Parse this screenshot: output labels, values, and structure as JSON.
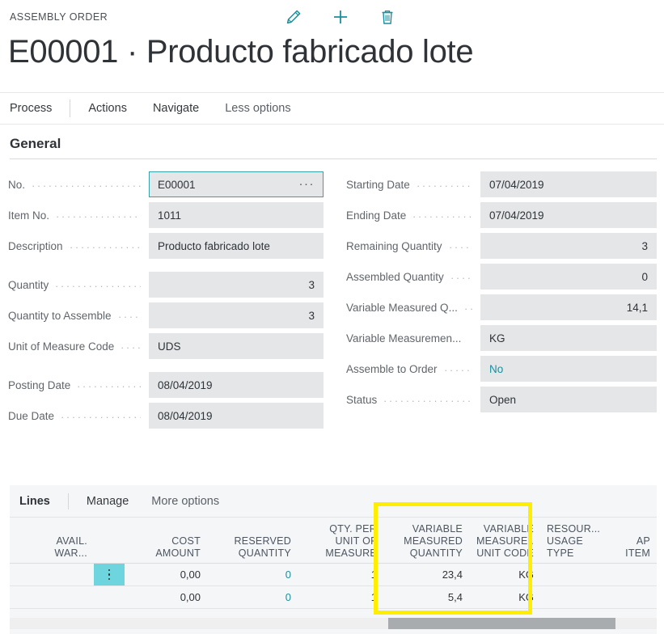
{
  "header": {
    "breadcrumb": "ASSEMBLY ORDER",
    "title_no": "E00001",
    "title_sep": "·",
    "title_desc": "Producto fabricado lote",
    "icons": [
      {
        "name": "edit-pencil-icon",
        "label": "Edit"
      },
      {
        "name": "plus-icon",
        "label": "New"
      },
      {
        "name": "trash-icon",
        "label": "Delete"
      }
    ]
  },
  "ribbon": {
    "process": "Process",
    "actions": "Actions",
    "navigate": "Navigate",
    "less_options": "Less options"
  },
  "general": {
    "heading": "General",
    "left": [
      {
        "label": "No.",
        "value": "E00001",
        "align": "left",
        "focused": true,
        "assist": "···"
      },
      {
        "label": "Item No.",
        "value": "1011",
        "align": "left"
      },
      {
        "label": "Description",
        "value": "Producto fabricado lote",
        "align": "left"
      },
      {
        "label": "Quantity",
        "value": "3",
        "align": "right",
        "gap": true
      },
      {
        "label": "Quantity to Assemble",
        "value": "3",
        "align": "right"
      },
      {
        "label": "Unit of Measure Code",
        "value": "UDS",
        "align": "left"
      },
      {
        "label": "Posting Date",
        "value": "08/04/2019",
        "align": "left",
        "gap": true
      },
      {
        "label": "Due Date",
        "value": "08/04/2019",
        "align": "left"
      }
    ],
    "right": [
      {
        "label": "Starting Date",
        "value": "07/04/2019",
        "align": "left"
      },
      {
        "label": "Ending Date",
        "value": "07/04/2019",
        "align": "left"
      },
      {
        "label": "Remaining Quantity",
        "value": "3",
        "align": "right"
      },
      {
        "label": "Assembled Quantity",
        "value": "0",
        "align": "right"
      },
      {
        "label": "Variable Measured Q...",
        "value": "14,1",
        "align": "right"
      },
      {
        "label": "Variable Measuremen...",
        "value": "KG",
        "align": "left"
      },
      {
        "label": "Assemble to Order",
        "value": "No",
        "align": "left",
        "link": true
      },
      {
        "label": "Status",
        "value": "Open",
        "align": "left"
      }
    ]
  },
  "lines": {
    "title": "Lines",
    "manage": "Manage",
    "more_options": "More options",
    "columns": [
      {
        "key": "avail",
        "lines": [
          "AVAIL.",
          "WAR..."
        ],
        "align": "right"
      },
      {
        "key": "sel",
        "lines": [],
        "align": "left"
      },
      {
        "key": "cost",
        "lines": [
          "COST",
          "AMOUNT"
        ],
        "align": "right"
      },
      {
        "key": "resv",
        "lines": [
          "RESERVED",
          "QUANTITY"
        ],
        "align": "right"
      },
      {
        "key": "qpu",
        "lines": [
          "QTY. PER",
          "UNIT OF",
          "MEASURE"
        ],
        "align": "right"
      },
      {
        "key": "vmq",
        "lines": [
          "VARIABLE",
          "MEASURED",
          "QUANTITY"
        ],
        "align": "right"
      },
      {
        "key": "vmu",
        "lines": [
          "VARIABLE",
          "MEASURE..",
          "UNIT CODE"
        ],
        "align": "right"
      },
      {
        "key": "rut",
        "lines": [
          "RESOUR...",
          "USAGE",
          "TYPE"
        ],
        "align": "left"
      },
      {
        "key": "ap",
        "lines": [
          "AP",
          "ITEM"
        ],
        "align": "right"
      }
    ],
    "rows": [
      {
        "selected": true,
        "avail": "",
        "cost": "0,00",
        "resv": "0",
        "qpu": "1",
        "vmq": "23,4",
        "vmu": "KG",
        "rut": "",
        "ap": ""
      },
      {
        "selected": false,
        "avail": "",
        "cost": "0,00",
        "resv": "0",
        "qpu": "1",
        "vmq": "5,4",
        "vmu": "KG",
        "rut": "",
        "ap": ""
      }
    ]
  },
  "annotation": {
    "highlight_color": "#ffee00",
    "highlight_target": "variable-measured-quantity-and-unit-code-columns"
  },
  "colors": {
    "accent_teal": "#1a8f9e",
    "field_bg": "#e4e6e8",
    "row_select": "#6ed4dd",
    "highlight": "#ffee00"
  }
}
